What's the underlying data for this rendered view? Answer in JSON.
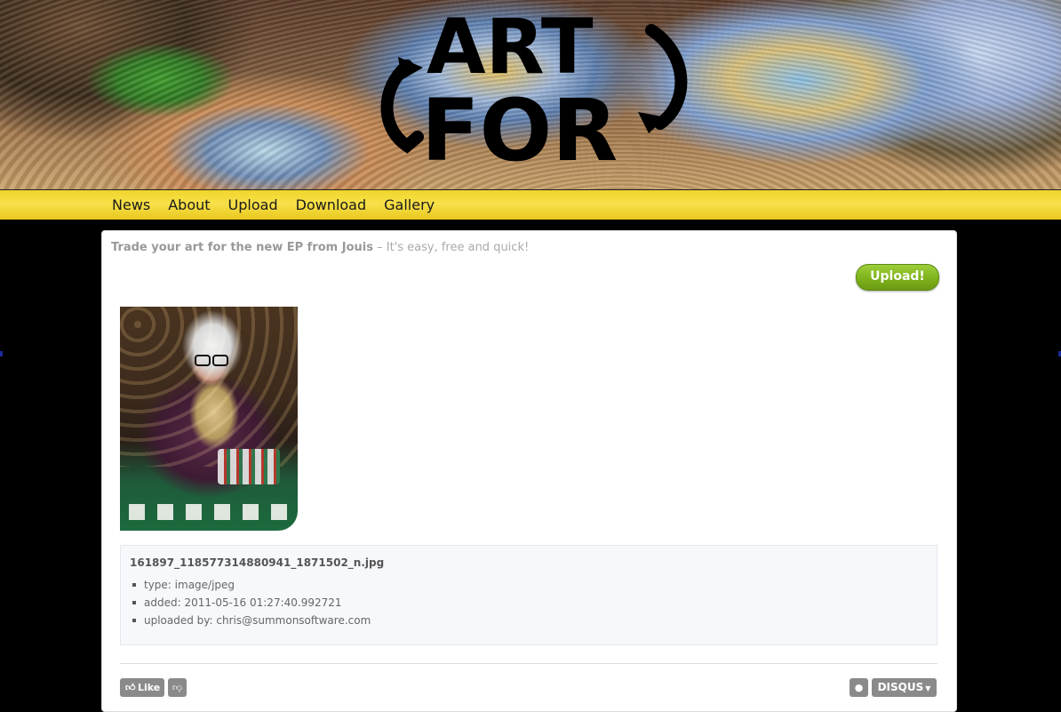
{
  "header": {
    "logo_text": [
      "ART",
      "FOR"
    ]
  },
  "nav": {
    "items": [
      {
        "label": "News"
      },
      {
        "label": "About"
      },
      {
        "label": "Upload"
      },
      {
        "label": "Download"
      },
      {
        "label": "Gallery"
      }
    ]
  },
  "panel": {
    "tagline_bold": "Trade your art for the new EP from Jouis",
    "tagline_rest": " – It's easy, free and quick!",
    "upload_label": "Upload!"
  },
  "file": {
    "filename": "161897_118577314880941_1871502_n.jpg",
    "details": [
      "type: image/jpeg",
      "added: 2011-05-16 01:27:40.992721",
      "uploaded by: chris@summonsoftware.com"
    ]
  },
  "comments": {
    "like_label": "Like",
    "brand_label": "DISQUS"
  },
  "icons": {
    "like": "thumbs-up-icon",
    "dislike": "thumbs-down-icon",
    "user": "user-icon",
    "dropdown": "caret-down-icon"
  },
  "colors": {
    "nav_bar": "#f0d52a",
    "upload_button": "#7fb21c",
    "page_background": "#000000"
  }
}
